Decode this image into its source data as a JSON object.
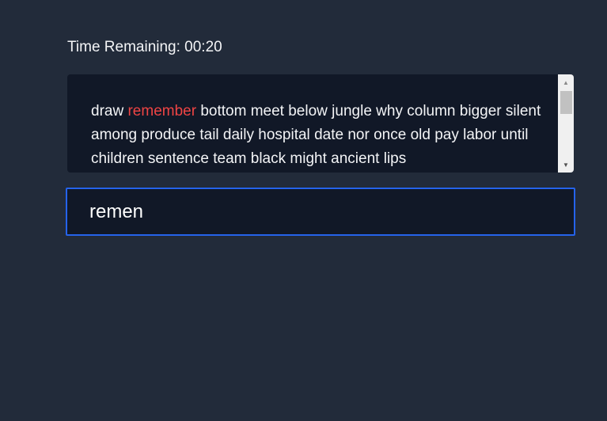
{
  "timer": {
    "label": "Time Remaining: 00:20"
  },
  "words": [
    "draw",
    "remember",
    "bottom",
    "meet",
    "below",
    "jungle",
    "why",
    "column",
    "bigger",
    "silent",
    "among",
    "produce",
    "tail",
    "daily",
    "hospital",
    "date",
    "nor",
    "once",
    "old",
    "pay",
    "labor",
    "until",
    "children",
    "sentence",
    "team",
    "black",
    "might",
    "ancient",
    "lips"
  ],
  "current_word_index": 1,
  "input": {
    "value": "remen",
    "placeholder": ""
  },
  "colors": {
    "background": "#222b3a",
    "panel": "#111827",
    "current_word": "#ef4444",
    "input_border": "#2563eb"
  },
  "icons": {
    "scroll_up": "scroll-up-arrow-icon",
    "scroll_down": "scroll-down-arrow-icon"
  }
}
